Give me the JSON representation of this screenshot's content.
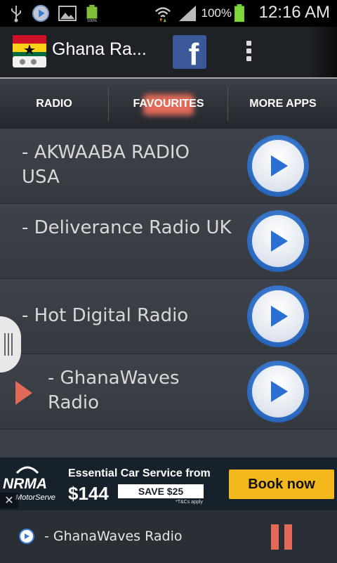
{
  "status_bar": {
    "battery_percent_text": "100%",
    "time": "12:16 AM",
    "icons": [
      "usb-icon",
      "play-circle-icon",
      "picture-icon",
      "battery-small-icon",
      "wifi-icon",
      "signal-icon",
      "battery-icon"
    ]
  },
  "action_bar": {
    "title": "Ghana Ra...",
    "facebook_letter": "f",
    "icons": [
      "ghana-flag-icon",
      "facebook-icon",
      "overflow-menu-icon"
    ]
  },
  "tabs": [
    {
      "label": "RADIO",
      "selected": false
    },
    {
      "label": "FAVOURITES",
      "selected": true
    },
    {
      "label": "MORE APPS",
      "selected": false
    }
  ],
  "stations": [
    {
      "label": "- AKWAABA RADIO USA",
      "playing": false
    },
    {
      "label": "- Deliverance Radio UK",
      "playing": false
    },
    {
      "label": "- Hot Digital Radio",
      "playing": false
    },
    {
      "label": "- GhanaWaves Radio",
      "playing": true
    }
  ],
  "ad": {
    "logo_text": "NRMA",
    "logo_sub": "MotorServe",
    "headline": "Essential Car Service from",
    "price": "$144",
    "save": "SAVE $25",
    "tcs": "*T&Cs apply",
    "cta": "Book now",
    "close": "✕"
  },
  "player": {
    "now_playing": "- GhanaWaves Radio"
  },
  "colors": {
    "accent": "#e36a58",
    "play_blue": "#2a6fd1",
    "facebook": "#3b5998",
    "ad_cta": "#f3b81b"
  }
}
